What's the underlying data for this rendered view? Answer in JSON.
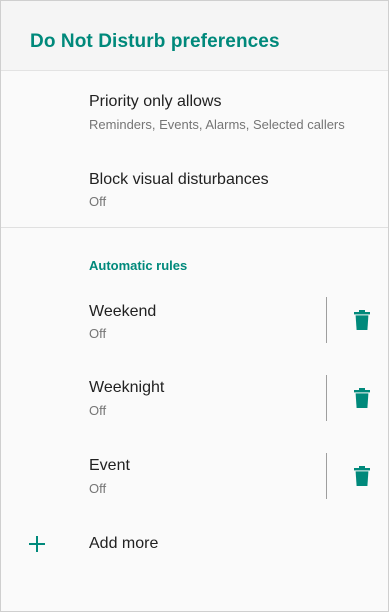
{
  "header": {
    "title": "Do Not Disturb preferences"
  },
  "settings": [
    {
      "primary": "Priority only allows",
      "secondary": "Reminders, Events, Alarms, Selected callers"
    },
    {
      "primary": "Block visual disturbances",
      "secondary": "Off"
    }
  ],
  "automatic_rules": {
    "header": "Automatic rules",
    "rules": [
      {
        "name": "Weekend",
        "status": "Off"
      },
      {
        "name": "Weeknight",
        "status": "Off"
      },
      {
        "name": "Event",
        "status": "Off"
      }
    ],
    "add_label": "Add more"
  },
  "icons": {
    "delete": "trash-icon",
    "add": "plus-icon"
  },
  "colors": {
    "accent": "#00897b",
    "primary_text": "#212121",
    "secondary_text": "#757575"
  }
}
